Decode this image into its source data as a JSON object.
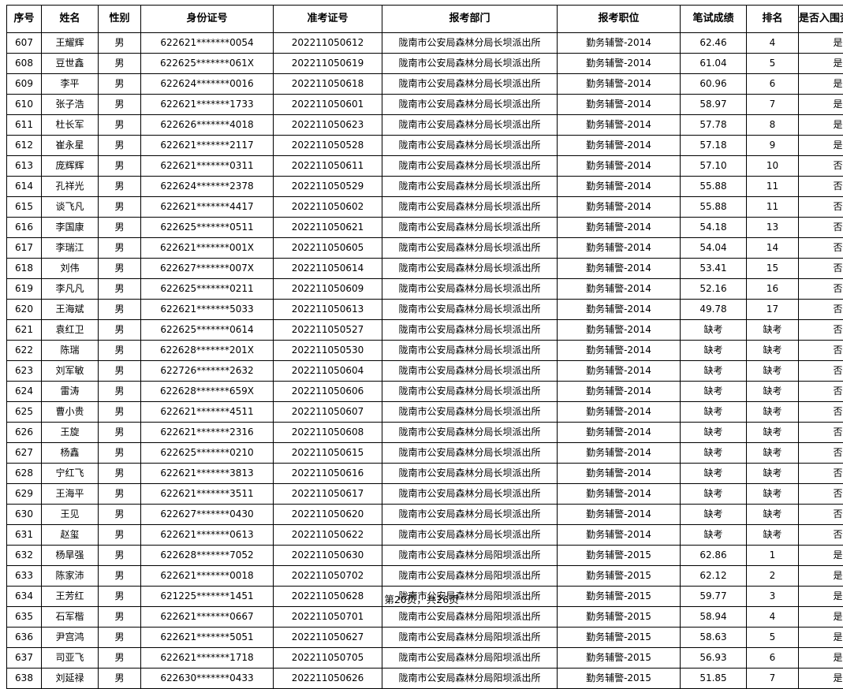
{
  "table": {
    "headers": [
      "序号",
      "姓名",
      "性别",
      "身份证号",
      "准考证号",
      "报考部门",
      "报考职位",
      "笔试成绩",
      "排名",
      "是否入围资格复审"
    ],
    "rows": [
      [
        "607",
        "王耀辉",
        "男",
        "622621*******0054",
        "202211050612",
        "陇南市公安局森林分局长坝派出所",
        "勤务辅警-2014",
        "62.46",
        "4",
        "是"
      ],
      [
        "608",
        "豆世鑫",
        "男",
        "622625*******061X",
        "202211050619",
        "陇南市公安局森林分局长坝派出所",
        "勤务辅警-2014",
        "61.04",
        "5",
        "是"
      ],
      [
        "609",
        "李平",
        "男",
        "622624*******0016",
        "202211050618",
        "陇南市公安局森林分局长坝派出所",
        "勤务辅警-2014",
        "60.96",
        "6",
        "是"
      ],
      [
        "610",
        "张子浩",
        "男",
        "622621*******1733",
        "202211050601",
        "陇南市公安局森林分局长坝派出所",
        "勤务辅警-2014",
        "58.97",
        "7",
        "是"
      ],
      [
        "611",
        "杜长军",
        "男",
        "622626*******4018",
        "202211050623",
        "陇南市公安局森林分局长坝派出所",
        "勤务辅警-2014",
        "57.78",
        "8",
        "是"
      ],
      [
        "612",
        "崔永星",
        "男",
        "622621*******2117",
        "202211050528",
        "陇南市公安局森林分局长坝派出所",
        "勤务辅警-2014",
        "57.18",
        "9",
        "是"
      ],
      [
        "613",
        "庞辉辉",
        "男",
        "622621*******0311",
        "202211050611",
        "陇南市公安局森林分局长坝派出所",
        "勤务辅警-2014",
        "57.10",
        "10",
        "否"
      ],
      [
        "614",
        "孔祥光",
        "男",
        "622624*******2378",
        "202211050529",
        "陇南市公安局森林分局长坝派出所",
        "勤务辅警-2014",
        "55.88",
        "11",
        "否"
      ],
      [
        "615",
        "谈飞凡",
        "男",
        "622621*******4417",
        "202211050602",
        "陇南市公安局森林分局长坝派出所",
        "勤务辅警-2014",
        "55.88",
        "11",
        "否"
      ],
      [
        "616",
        "李国康",
        "男",
        "622625*******0511",
        "202211050621",
        "陇南市公安局森林分局长坝派出所",
        "勤务辅警-2014",
        "54.18",
        "13",
        "否"
      ],
      [
        "617",
        "李瑞江",
        "男",
        "622621*******001X",
        "202211050605",
        "陇南市公安局森林分局长坝派出所",
        "勤务辅警-2014",
        "54.04",
        "14",
        "否"
      ],
      [
        "618",
        "刘伟",
        "男",
        "622627*******007X",
        "202211050614",
        "陇南市公安局森林分局长坝派出所",
        "勤务辅警-2014",
        "53.41",
        "15",
        "否"
      ],
      [
        "619",
        "李凡凡",
        "男",
        "622625*******0211",
        "202211050609",
        "陇南市公安局森林分局长坝派出所",
        "勤务辅警-2014",
        "52.16",
        "16",
        "否"
      ],
      [
        "620",
        "王海斌",
        "男",
        "622621*******5033",
        "202211050613",
        "陇南市公安局森林分局长坝派出所",
        "勤务辅警-2014",
        "49.78",
        "17",
        "否"
      ],
      [
        "621",
        "袁红卫",
        "男",
        "622625*******0614",
        "202211050527",
        "陇南市公安局森林分局长坝派出所",
        "勤务辅警-2014",
        "缺考",
        "缺考",
        "否"
      ],
      [
        "622",
        "陈瑞",
        "男",
        "622628*******201X",
        "202211050530",
        "陇南市公安局森林分局长坝派出所",
        "勤务辅警-2014",
        "缺考",
        "缺考",
        "否"
      ],
      [
        "623",
        "刘军敏",
        "男",
        "622726*******2632",
        "202211050604",
        "陇南市公安局森林分局长坝派出所",
        "勤务辅警-2014",
        "缺考",
        "缺考",
        "否"
      ],
      [
        "624",
        "雷涛",
        "男",
        "622628*******659X",
        "202211050606",
        "陇南市公安局森林分局长坝派出所",
        "勤务辅警-2014",
        "缺考",
        "缺考",
        "否"
      ],
      [
        "625",
        "曹小贵",
        "男",
        "622621*******4511",
        "202211050607",
        "陇南市公安局森林分局长坝派出所",
        "勤务辅警-2014",
        "缺考",
        "缺考",
        "否"
      ],
      [
        "626",
        "王旋",
        "男",
        "622621*******2316",
        "202211050608",
        "陇南市公安局森林分局长坝派出所",
        "勤务辅警-2014",
        "缺考",
        "缺考",
        "否"
      ],
      [
        "627",
        "杨鑫",
        "男",
        "622625*******0210",
        "202211050615",
        "陇南市公安局森林分局长坝派出所",
        "勤务辅警-2014",
        "缺考",
        "缺考",
        "否"
      ],
      [
        "628",
        "宁红飞",
        "男",
        "622621*******3813",
        "202211050616",
        "陇南市公安局森林分局长坝派出所",
        "勤务辅警-2014",
        "缺考",
        "缺考",
        "否"
      ],
      [
        "629",
        "王海平",
        "男",
        "622621*******3511",
        "202211050617",
        "陇南市公安局森林分局长坝派出所",
        "勤务辅警-2014",
        "缺考",
        "缺考",
        "否"
      ],
      [
        "630",
        "王见",
        "男",
        "622627*******0430",
        "202211050620",
        "陇南市公安局森林分局长坝派出所",
        "勤务辅警-2014",
        "缺考",
        "缺考",
        "否"
      ],
      [
        "631",
        "赵玺",
        "男",
        "622621*******0613",
        "202211050622",
        "陇南市公安局森林分局长坝派出所",
        "勤务辅警-2014",
        "缺考",
        "缺考",
        "否"
      ],
      [
        "632",
        "杨旱强",
        "男",
        "622628*******7052",
        "202211050630",
        "陇南市公安局森林分局阳坝派出所",
        "勤务辅警-2015",
        "62.86",
        "1",
        "是"
      ],
      [
        "633",
        "陈家沛",
        "男",
        "622621*******0018",
        "202211050702",
        "陇南市公安局森林分局阳坝派出所",
        "勤务辅警-2015",
        "62.12",
        "2",
        "是"
      ],
      [
        "634",
        "王芳红",
        "男",
        "621225*******1451",
        "202211050628",
        "陇南市公安局森林分局阳坝派出所",
        "勤务辅警-2015",
        "59.77",
        "3",
        "是"
      ],
      [
        "635",
        "石军楷",
        "男",
        "622621*******0667",
        "202211050701",
        "陇南市公安局森林分局阳坝派出所",
        "勤务辅警-2015",
        "58.94",
        "4",
        "是"
      ],
      [
        "636",
        "尹宫鸿",
        "男",
        "622621*******5051",
        "202211050627",
        "陇南市公安局森林分局阳坝派出所",
        "勤务辅警-2015",
        "58.63",
        "5",
        "是"
      ],
      [
        "637",
        "司亚飞",
        "男",
        "622621*******1718",
        "202211050705",
        "陇南市公安局森林分局阳坝派出所",
        "勤务辅警-2015",
        "56.93",
        "6",
        "是"
      ],
      [
        "638",
        "刘延禄",
        "男",
        "622630*******0433",
        "202211050626",
        "陇南市公安局森林分局阳坝派出所",
        "勤务辅警-2015",
        "51.85",
        "7",
        "是"
      ]
    ]
  },
  "footer": {
    "text": "第20页，共26页"
  }
}
